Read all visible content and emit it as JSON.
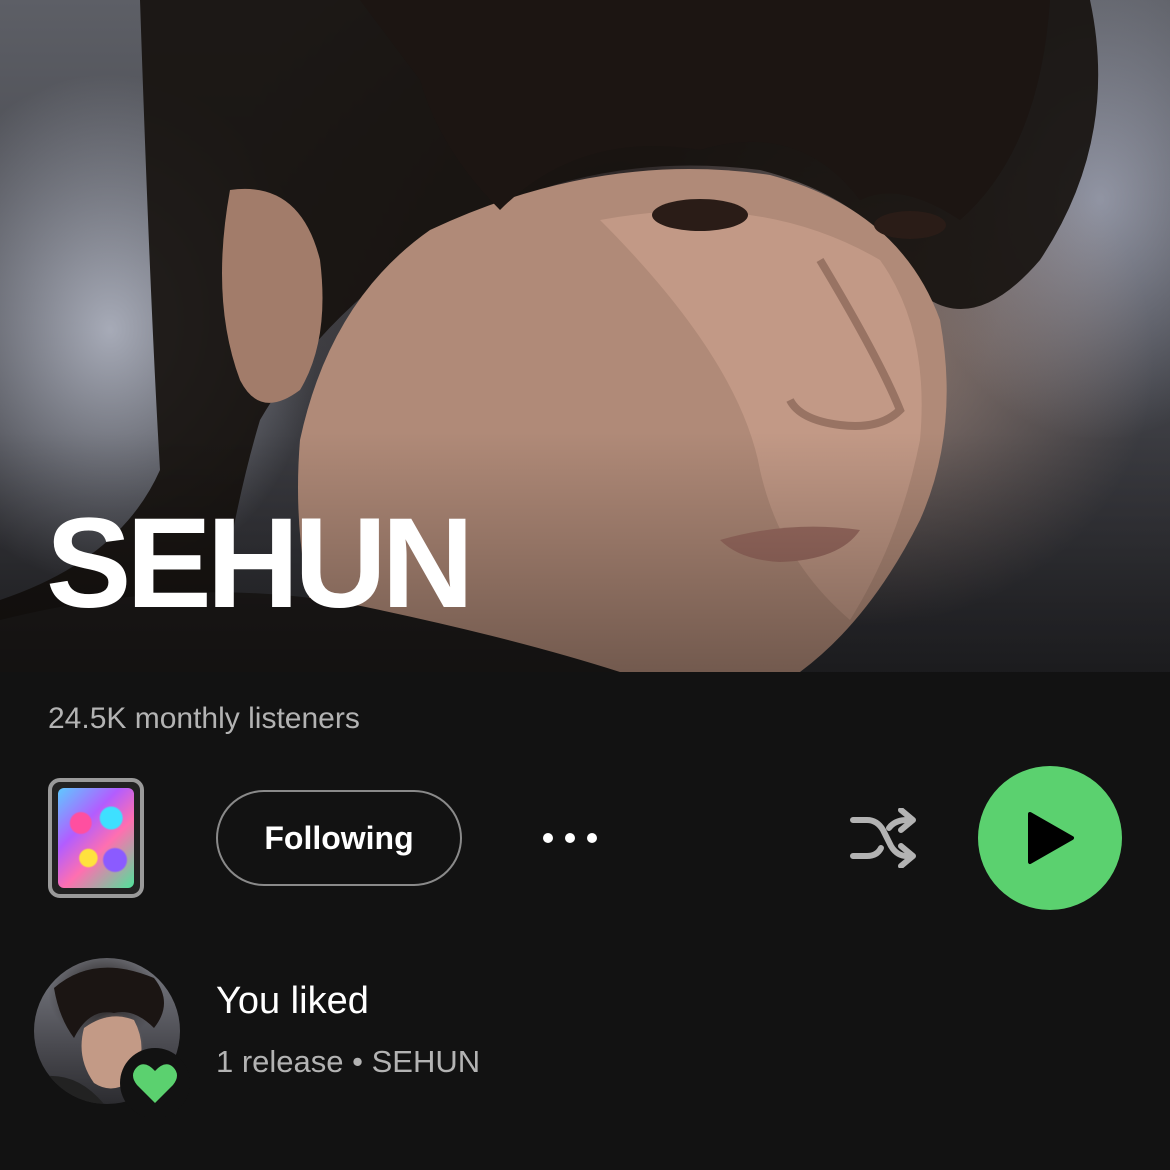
{
  "artist": {
    "name": "SEHUN",
    "monthly_listeners": "24.5K monthly listeners",
    "hero_image": "artist-portrait"
  },
  "controls": {
    "cover_thumbnail": "album-cover-thumbnail",
    "follow_label": "Following",
    "more_icon": "more-options-icon",
    "shuffle_icon": "shuffle-icon",
    "play_icon": "play-icon",
    "accent_color": "#5bd16f"
  },
  "liked": {
    "title": "You liked",
    "subtitle": "1 release • SEHUN",
    "badge_icon": "heart-icon"
  }
}
